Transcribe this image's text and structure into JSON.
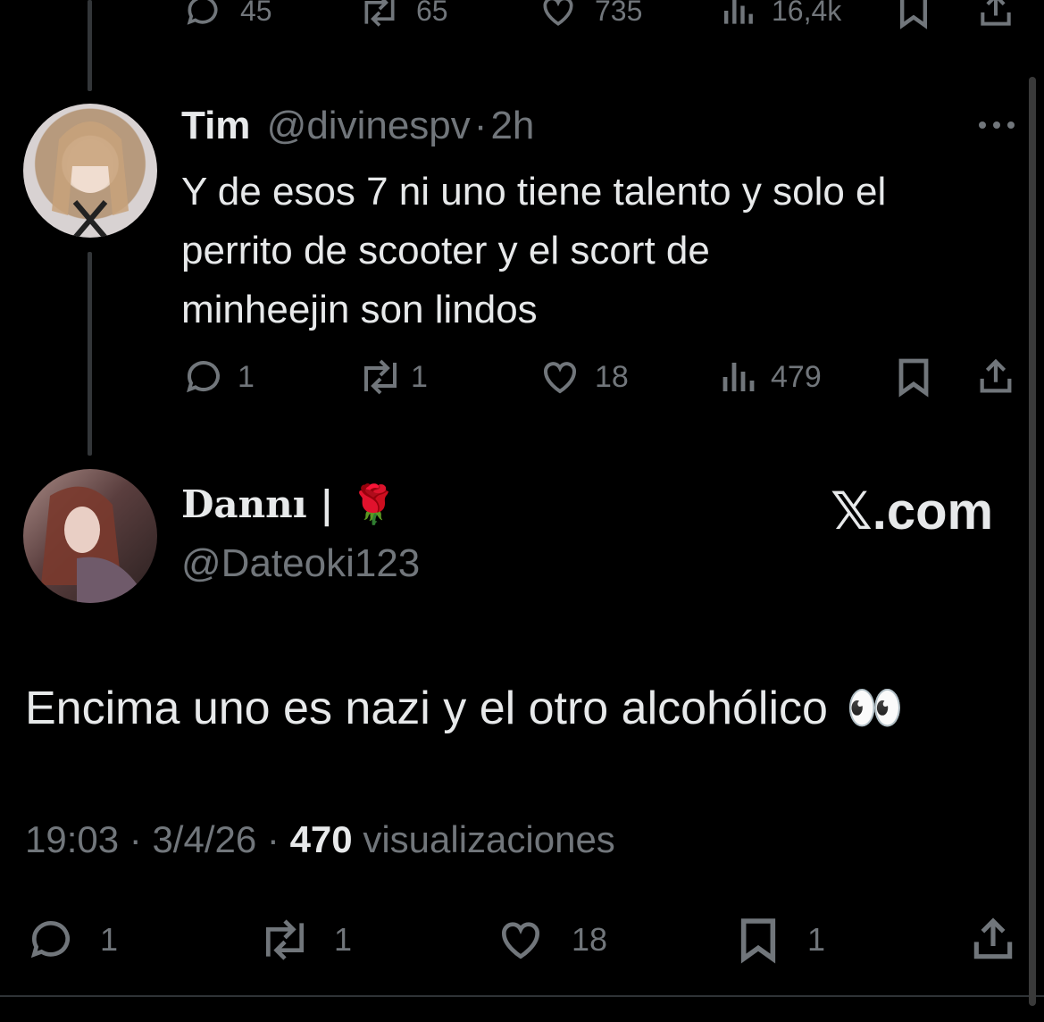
{
  "top_actions": {
    "replies": "45",
    "reposts": "65",
    "likes": "735",
    "views": "16,4k"
  },
  "reply_tweet": {
    "name": "Tim",
    "handle": "@divinespv",
    "sep": "·",
    "time": "2h",
    "text_lines": [
      "Y de esos 7 ni uno tiene talento y solo el",
      "perrito de scooter y el scort de",
      "minheejin son lindos"
    ],
    "actions": {
      "replies": "1",
      "reposts": "1",
      "likes": "18",
      "views": "479"
    }
  },
  "main_tweet": {
    "name": "Dannı |",
    "name_emoji": "🌹",
    "handle": "@Dateoki123",
    "watermark": "𝕏.com",
    "text": "Encima uno es nazi y el otro alcohólico",
    "text_emoji": "👀",
    "meta": {
      "time": "19:03",
      "sep1": "·",
      "date": "3/4/26",
      "sep2": "·",
      "views_count": "470",
      "views_label": "visualizaciones"
    },
    "actions": {
      "replies": "1",
      "reposts": "1",
      "likes": "18",
      "bookmarks": "1"
    }
  },
  "icons": [
    "reply-icon",
    "repost-icon",
    "like-icon",
    "views-icon",
    "bookmark-icon",
    "share-icon",
    "more-icon"
  ]
}
